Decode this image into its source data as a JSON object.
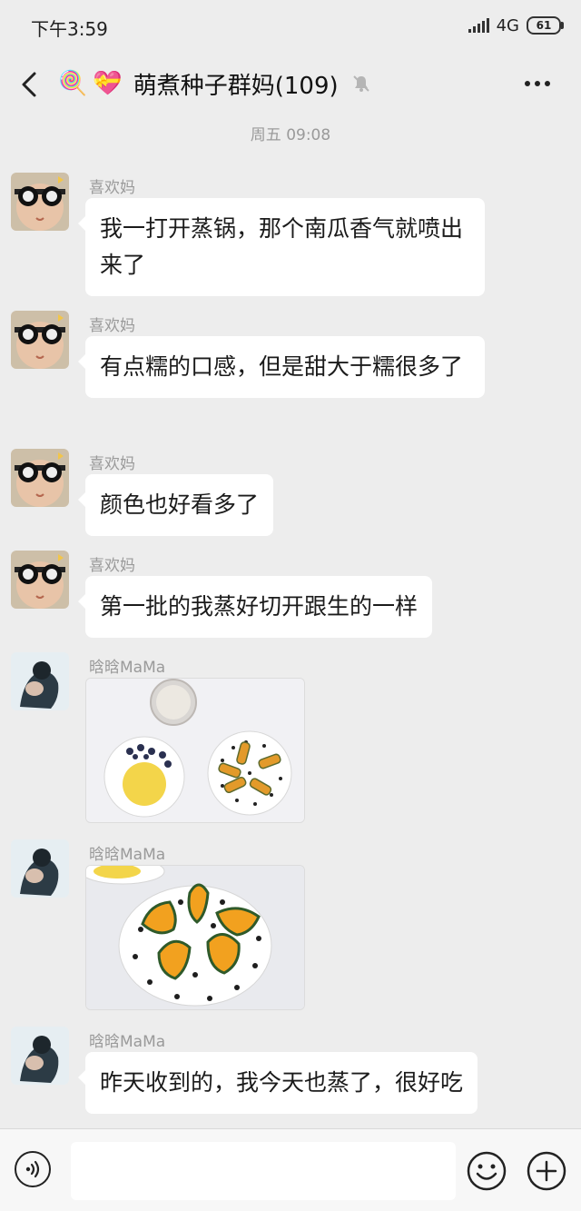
{
  "status": {
    "time": "下午3:59",
    "network": "4G",
    "battery": "61"
  },
  "header": {
    "title": "萌煮种子群妈(109)",
    "emoji": [
      "🍭",
      "💝"
    ]
  },
  "chat": {
    "timestamp": "周五 09:08",
    "messages": [
      {
        "sender": "喜欢妈",
        "text": "我一打开蒸锅，那个南瓜香气就喷出来了"
      },
      {
        "sender": "喜欢妈",
        "text": "有点糯的口感，但是甜大于糯很多了"
      },
      {
        "sender": "喜欢妈",
        "text": "颜色也好看多了"
      },
      {
        "sender": "喜欢妈",
        "text": "第一批的我蒸好切开跟生的一样"
      },
      {
        "sender": "晗晗MaMa",
        "image": "photo-plates"
      },
      {
        "sender": "晗晗MaMa",
        "image": "photo-pumpkin"
      },
      {
        "sender": "晗晗MaMa",
        "text": "昨天收到的，我今天也蒸了，很好吃"
      }
    ]
  },
  "input": {
    "placeholder": ""
  },
  "icons": [
    "back-icon",
    "mute-icon",
    "more-icon",
    "voice-icon",
    "emoji-icon",
    "plus-icon"
  ]
}
